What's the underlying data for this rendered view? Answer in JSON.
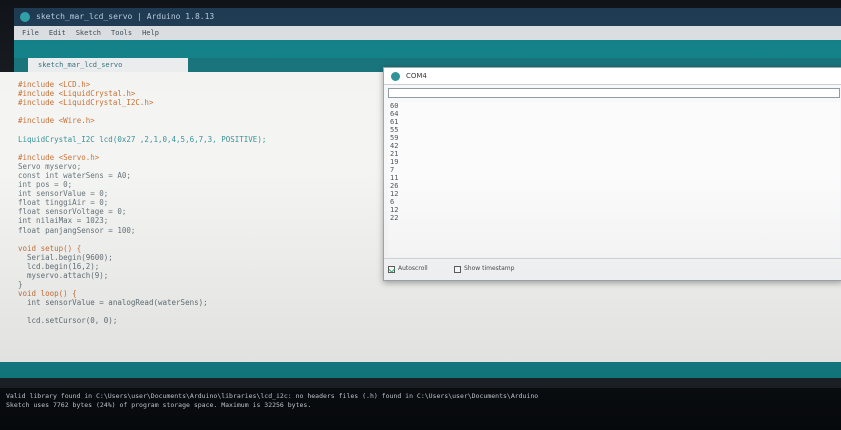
{
  "window": {
    "title": "sketch_mar_lcd_servo | Arduino 1.8.13",
    "menu": [
      "File",
      "Edit",
      "Sketch",
      "Tools",
      "Help"
    ]
  },
  "tab": {
    "label": "sketch_mar_lcd_servo"
  },
  "code_lines": [
    {
      "text": "#include <LCD.h>",
      "cls": "kw"
    },
    {
      "text": "#include <LiquidCrystal.h>",
      "cls": "kw"
    },
    {
      "text": "#include <LiquidCrystal_I2C.h>",
      "cls": "kw"
    },
    {
      "text": "",
      "cls": ""
    },
    {
      "text": "#include <Wire.h>",
      "cls": "kw"
    },
    {
      "text": "",
      "cls": ""
    },
    {
      "text": "LiquidCrystal_I2C lcd(0x27 ,2,1,0,4,5,6,7,3, POSITIVE);",
      "cls": "ty"
    },
    {
      "text": "",
      "cls": ""
    },
    {
      "text": "#include <Servo.h>",
      "cls": "kw"
    },
    {
      "text": "Servo myservo;",
      "cls": ""
    },
    {
      "text": "const int waterSens = A0;",
      "cls": ""
    },
    {
      "text": "int pos = 0;",
      "cls": ""
    },
    {
      "text": "int sensorValue = 0;",
      "cls": ""
    },
    {
      "text": "float tinggiAir = 0;",
      "cls": ""
    },
    {
      "text": "float sensorVoltage = 0;",
      "cls": ""
    },
    {
      "text": "int nilaiMax = 1023;",
      "cls": ""
    },
    {
      "text": "float panjangSensor = 100;",
      "cls": ""
    },
    {
      "text": "",
      "cls": ""
    },
    {
      "text": "void setup() {",
      "cls": "kw"
    },
    {
      "text": "  Serial.begin(9600);",
      "cls": ""
    },
    {
      "text": "  lcd.begin(16,2);",
      "cls": ""
    },
    {
      "text": "  myservo.attach(9);",
      "cls": ""
    },
    {
      "text": "}",
      "cls": ""
    },
    {
      "text": "void loop() {",
      "cls": "kw"
    },
    {
      "text": "  int sensorValue = analogRead(waterSens);",
      "cls": ""
    },
    {
      "text": "",
      "cls": ""
    },
    {
      "text": "  lcd.setCursor(0, 0);",
      "cls": ""
    }
  ],
  "serial_monitor": {
    "title": "COM4",
    "send_value": "",
    "readings": [
      "60",
      "64",
      "61",
      "55",
      "59",
      "42",
      "21",
      "19",
      "7",
      "11",
      "26",
      "12",
      "6",
      "12",
      "22"
    ],
    "autoscroll_label": "Autoscroll",
    "autoscroll_checked": true,
    "timestamp_label": "Show timestamp",
    "timestamp_checked": false
  },
  "console": {
    "lines": [
      "Valid library found in C:\\Users\\user\\Documents\\Arduino\\libraries\\lcd_i2c: no headers files (.h) found in C:\\Users\\user\\Documents\\Arduino",
      "Sketch uses 7762 bytes (24%) of program storage space. Maximum is 32256 bytes."
    ]
  },
  "colors": {
    "teal": "#0f7f86",
    "keyword": "#c56a2e",
    "type": "#2d8a8f"
  }
}
